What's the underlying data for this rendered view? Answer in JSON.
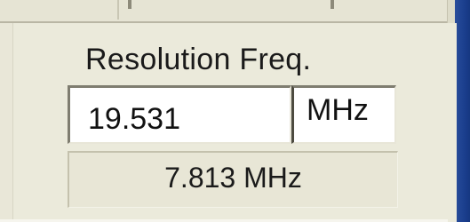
{
  "frequency_panel": {
    "label": "Resolution Freq.",
    "input_value": "19.531",
    "unit": "MHz",
    "computed_value": "7.813 MHz"
  },
  "colors": {
    "panel_background": "#ebeadb",
    "window_frame_blue": "#1b3f8e"
  }
}
